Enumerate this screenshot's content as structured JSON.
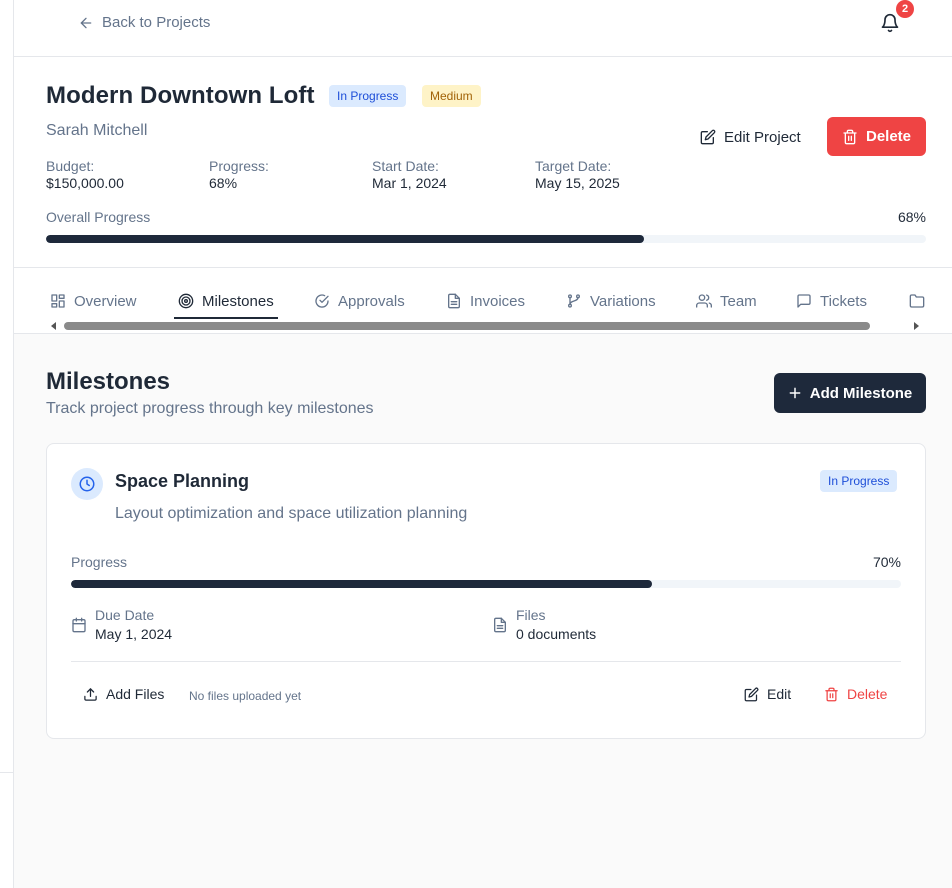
{
  "topbar": {
    "back_label": "Back to Projects",
    "notification_count": "2"
  },
  "project": {
    "title": "Modern Downtown Loft",
    "status": "In Progress",
    "priority": "Medium",
    "client": "Sarah Mitchell",
    "stats": [
      {
        "label": "Budget:",
        "value": "$150,000.00"
      },
      {
        "label": "Progress:",
        "value": "68%"
      },
      {
        "label": "Start Date:",
        "value": "Mar 1, 2024"
      },
      {
        "label": "Target Date:",
        "value": "May 15, 2025"
      }
    ],
    "edit_label": "Edit Project",
    "delete_label": "Delete",
    "overall_label": "Overall Progress",
    "overall_pct_text": "68%",
    "overall_progress": 0.68
  },
  "tabs": [
    {
      "label": "Overview",
      "icon": "grid-icon"
    },
    {
      "label": "Milestones",
      "icon": "target-icon",
      "active": true
    },
    {
      "label": "Approvals",
      "icon": "check-circle-icon"
    },
    {
      "label": "Invoices",
      "icon": "document-icon"
    },
    {
      "label": "Variations",
      "icon": "git-branch-icon"
    },
    {
      "label": "Team",
      "icon": "users-icon"
    },
    {
      "label": "Tickets",
      "icon": "message-icon"
    },
    {
      "label": "",
      "icon": "folder-icon"
    }
  ],
  "milestones_section": {
    "title": "Milestones",
    "subtitle": "Track project progress through key milestones",
    "add_label": "Add Milestone"
  },
  "milestone": {
    "title": "Space Planning",
    "status": "In Progress",
    "description": "Layout optimization and space utilization planning",
    "progress_label": "Progress",
    "progress_pct_text": "70%",
    "progress": 0.7,
    "due_label": "Due Date",
    "due_value": "May 1, 2024",
    "files_label": "Files",
    "files_value": "0 documents",
    "add_files_label": "Add Files",
    "no_files_text": "No files uploaded yet",
    "edit_label": "Edit",
    "delete_label": "Delete"
  },
  "colors": {
    "accent_dark": "#1e293b",
    "danger": "#ef4444",
    "status_blue_bg": "#dbeafe",
    "status_blue_text": "#1d4ed8",
    "medium_bg": "#fef3c7",
    "medium_text": "#a16207"
  }
}
